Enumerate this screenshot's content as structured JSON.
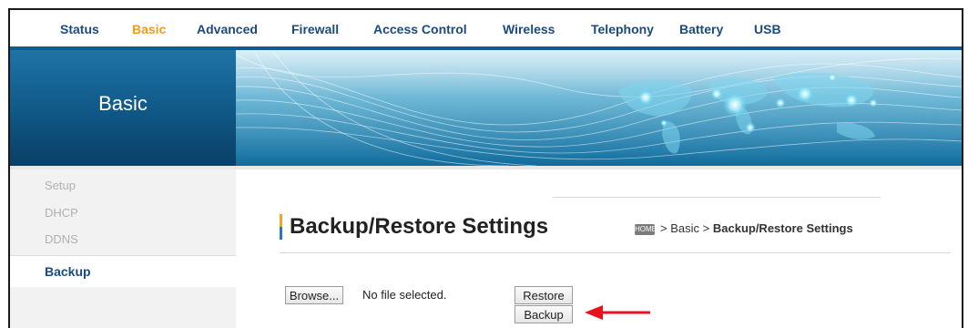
{
  "topnav": {
    "items": [
      {
        "label": "Status"
      },
      {
        "label": "Basic"
      },
      {
        "label": "Advanced"
      },
      {
        "label": "Firewall"
      },
      {
        "label": "Access Control"
      },
      {
        "label": "Wireless"
      },
      {
        "label": "Telephony"
      },
      {
        "label": "Battery"
      },
      {
        "label": "USB"
      }
    ],
    "active": "Basic"
  },
  "banner": {
    "section_title": "Basic"
  },
  "sidebar": {
    "items": [
      {
        "label": "Setup"
      },
      {
        "label": "DHCP"
      },
      {
        "label": "DDNS"
      },
      {
        "label": "Backup"
      }
    ],
    "active": "Backup"
  },
  "main": {
    "page_title": "Backup/Restore Settings",
    "breadcrumb": {
      "home_icon_text": "HOME",
      "separator": ">",
      "parent": "Basic",
      "current": "Backup/Restore Settings"
    },
    "file_input": {
      "browse_label": "Browse...",
      "status_text": "No file selected."
    },
    "restore_label": "Restore",
    "backup_label": "Backup"
  },
  "colors": {
    "nav_text": "#1a4a80",
    "nav_active": "#f39a1f",
    "banner_blue": "#0f5785",
    "annotation_arrow": "#e8121b"
  }
}
